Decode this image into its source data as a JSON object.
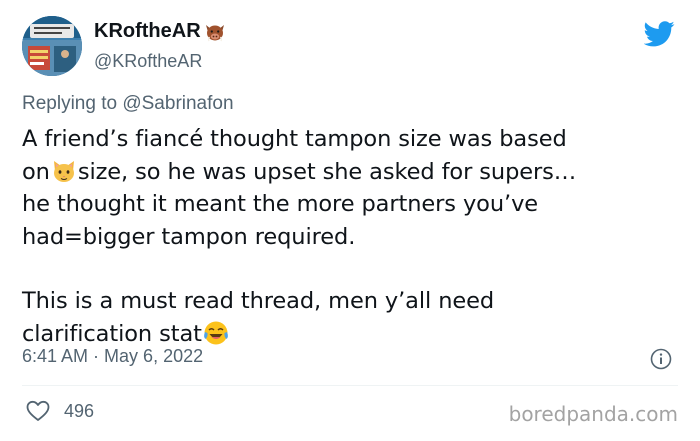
{
  "author": {
    "display_name": "KRoftheAR",
    "handle": "@KRoftheAR",
    "name_icon": "boar-face-icon",
    "avatar_icon": "profile-photo-street-sign-icon"
  },
  "platform_icon": "twitter-bird-icon",
  "reply": {
    "prefix": "Replying to ",
    "mention": "@Sabrinafon"
  },
  "body": {
    "line1": "A friend’s fiancé thought tampon size was based",
    "line2_pre": "on",
    "line2_emoji": "cat-face-icon",
    "line2_post": "size, so he was upset she asked for supers…",
    "line3": "he thought it meant the more partners you’ve",
    "line4": "had=bigger tampon required.",
    "line5": "This is a must read thread, men y’all need",
    "line6_pre": "clarification stat",
    "line6_emoji": "tears-of-joy-icon"
  },
  "meta": {
    "time": "6:41 AM",
    "separator": " · ",
    "date": "May 6, 2022"
  },
  "engagement": {
    "likes": "496"
  },
  "watermark": "boredpanda.com",
  "colors": {
    "twitter_blue": "#1d9bf0",
    "secondary_text": "#536471",
    "primary_text": "#0f1419"
  }
}
